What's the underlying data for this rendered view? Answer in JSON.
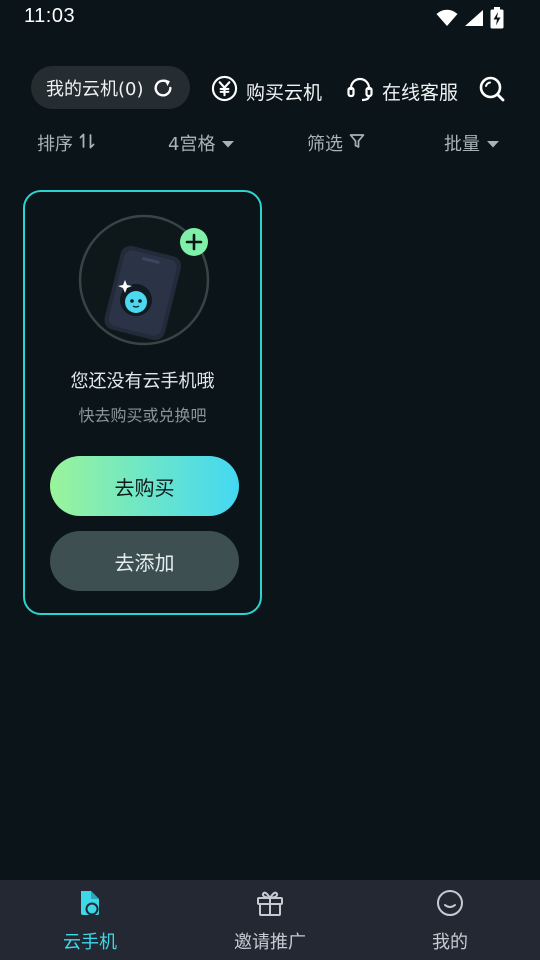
{
  "status_bar": {
    "time": "11:03",
    "icons": [
      "wifi-icon",
      "signal-icon",
      "battery-charging-icon"
    ]
  },
  "top_bar": {
    "my_cloud": "我的云机(0)",
    "buy_cloud": "购买云机",
    "support": "在线客服",
    "icons": [
      "refresh-icon",
      "yuan-icon",
      "headset-icon",
      "search-icon"
    ]
  },
  "filter_bar": {
    "sort": "排序",
    "grid": "4宫格",
    "filter": "筛选",
    "batch": "批量"
  },
  "empty_card": {
    "title": "您还没有云手机哦",
    "subtitle": "快去购买或兑换吧",
    "buy_button": "去购买",
    "add_button": "去添加"
  },
  "bottom_nav": {
    "items": [
      {
        "label": "云手机",
        "icon": "cloud-phone-icon",
        "active": true
      },
      {
        "label": "邀请推广",
        "icon": "gift-icon",
        "active": false
      },
      {
        "label": "我的",
        "icon": "profile-icon",
        "active": false
      }
    ]
  },
  "colors": {
    "background": "#0b1418",
    "accent": "#2ad4cf",
    "active_nav": "#3fd8e6",
    "nav_bg": "#232833"
  }
}
